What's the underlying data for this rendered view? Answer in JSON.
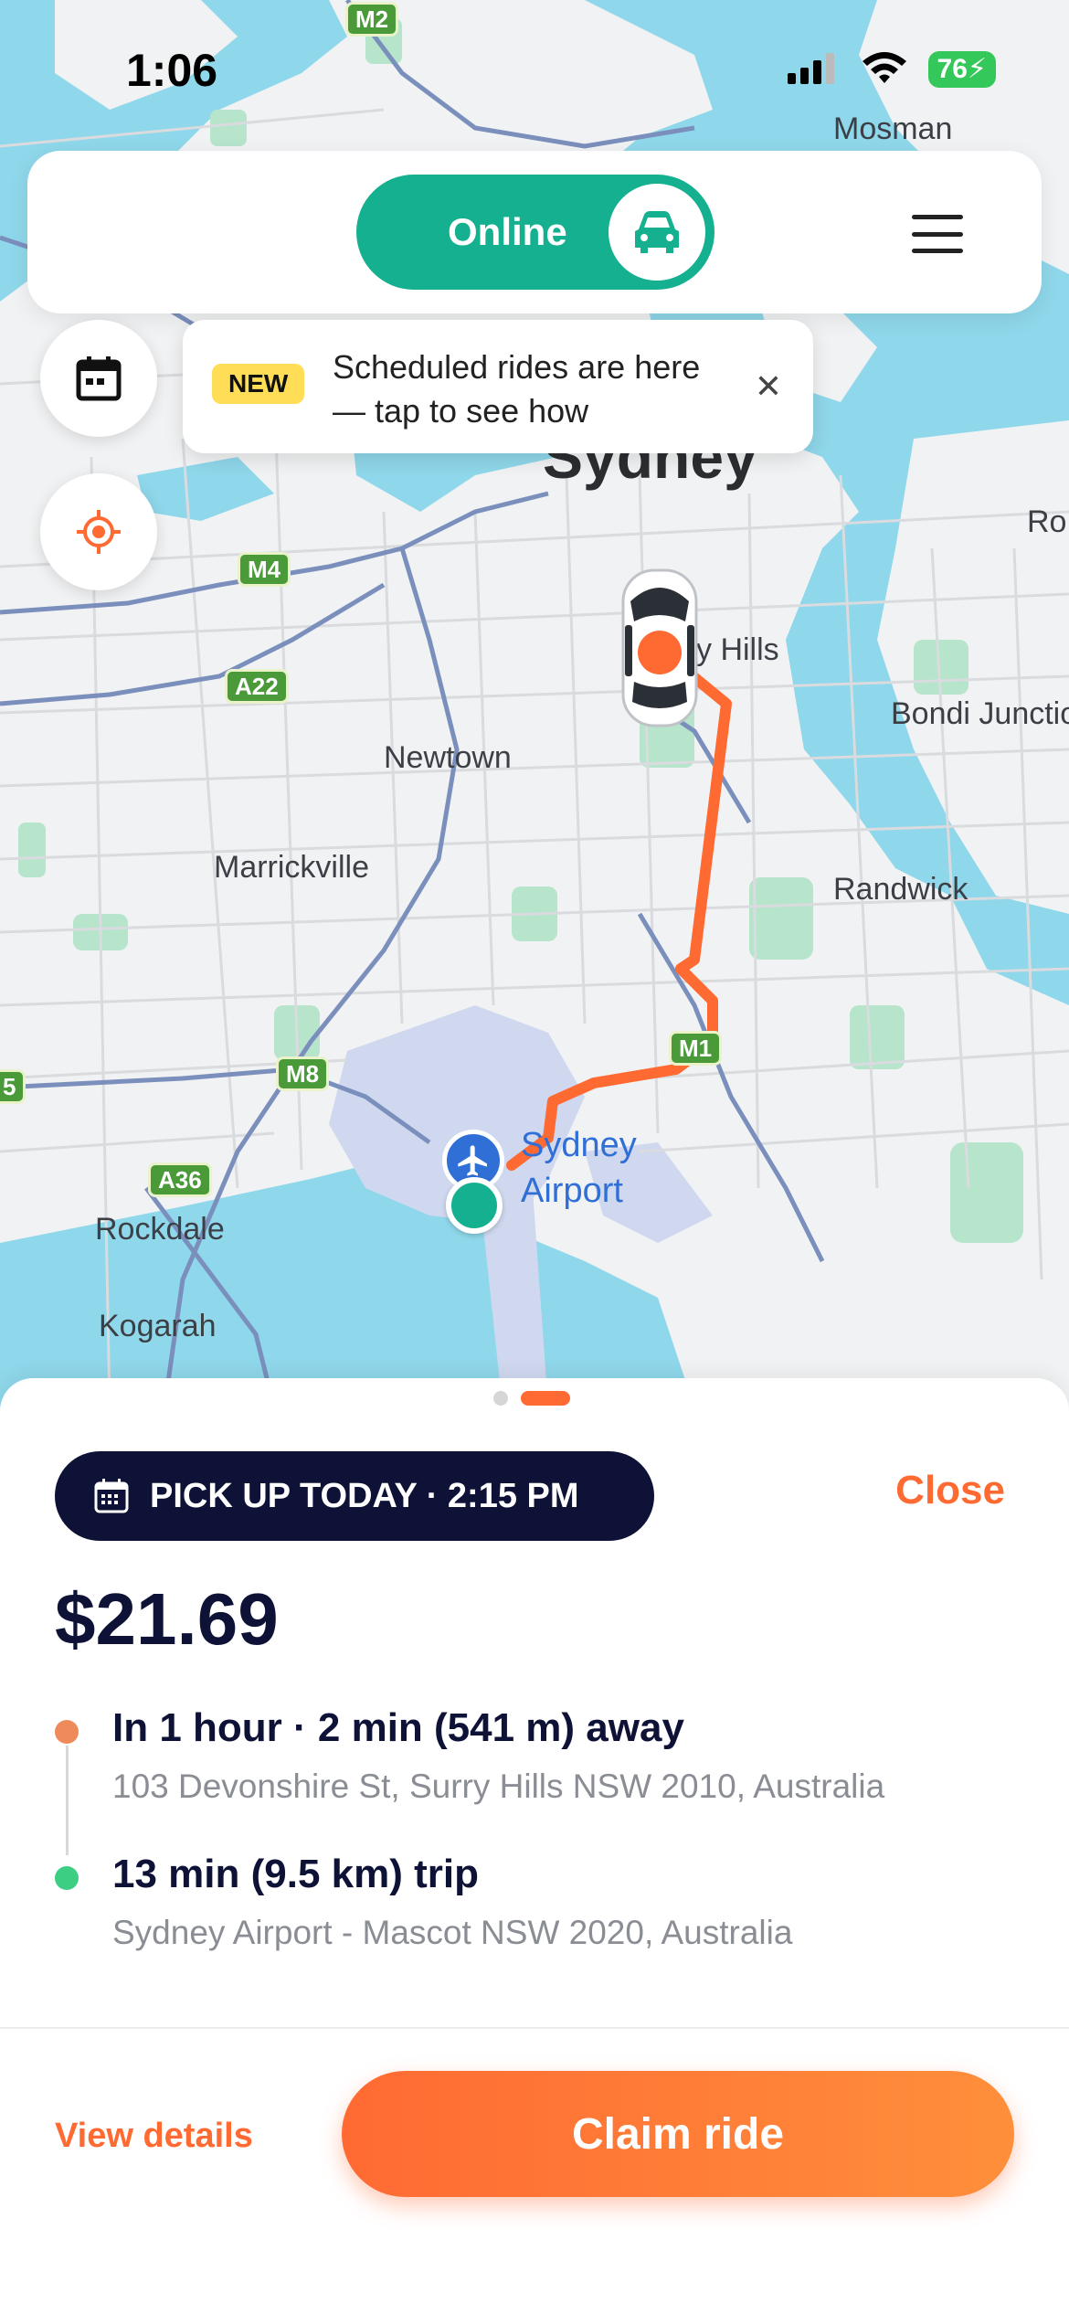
{
  "status_bar": {
    "time": "1:06",
    "battery": "76"
  },
  "map": {
    "labels": {
      "mosman": "Mosman",
      "sydney": "Sydney",
      "surry_hills": "y Hills",
      "bondi": "Bondi Junctio",
      "newtown": "Newtown",
      "marrickville": "Marrickville",
      "randwick": "Randwick",
      "rockdale": "Rockdale",
      "kogarah": "Kogarah",
      "airport_line1": "Sydney",
      "airport_line2": "Airport",
      "ro": "Ro"
    },
    "roads": {
      "m2": "M2",
      "m4": "M4",
      "a22": "A22",
      "m8": "M8",
      "m1": "M1",
      "a36": "A36",
      "r5": "5"
    }
  },
  "top_bar": {
    "status_label": "Online",
    "car_icon": "car-icon",
    "menu_icon": "hamburger-icon"
  },
  "tooltip": {
    "badge": "NEW",
    "text": "Scheduled rides are here — tap to see how",
    "close": "✕"
  },
  "sheet": {
    "pickup_label": "PICK UP TODAY · 2:15 PM",
    "close_label": "Close",
    "price": "$21.69",
    "stops": [
      {
        "title": "In 1 hour · 2 min (541 m) away",
        "address": "103 Devonshire St, Surry Hills NSW 2010, Australia",
        "color": "#ef8b5a"
      },
      {
        "title": "13 min (9.5 km) trip",
        "address": "Sydney Airport - Mascot NSW 2020, Australia",
        "color": "#3ccf84"
      }
    ],
    "view_details": "View details",
    "claim": "Claim ride"
  },
  "colors": {
    "accent": "#ff6a33",
    "online": "#14b08f",
    "navy": "#0d1236"
  }
}
